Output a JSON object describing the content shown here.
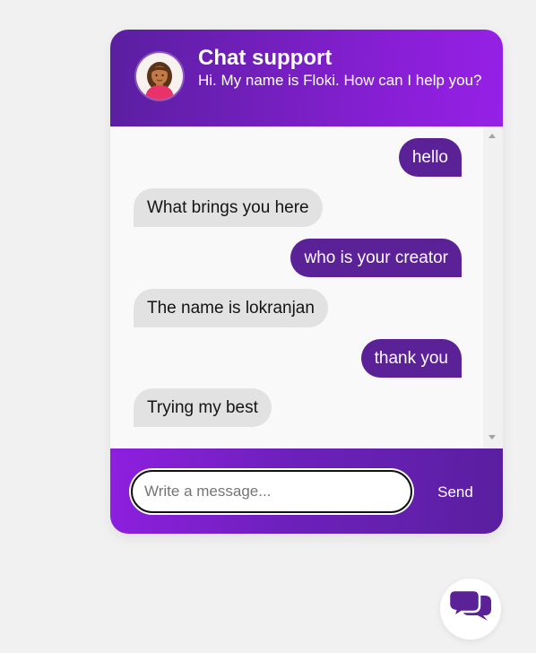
{
  "colors": {
    "accent": "#5b2298",
    "accent_light": "#9620e6",
    "received_bubble": "#e2e2e2",
    "page_bg": "#f1f1f1"
  },
  "header": {
    "title": "Chat support",
    "subtitle": "Hi. My name is Floki. How can I help you?",
    "avatar_icon": "woman-avatar-icon"
  },
  "messages": [
    {
      "sender": "user",
      "text": "hello"
    },
    {
      "sender": "bot",
      "text": "What brings you here"
    },
    {
      "sender": "user",
      "text": "who is your creator"
    },
    {
      "sender": "bot",
      "text": "The name is lokranjan"
    },
    {
      "sender": "user",
      "text": "thank you"
    },
    {
      "sender": "bot",
      "text": "Trying my best"
    }
  ],
  "input": {
    "placeholder": "Write a message...",
    "value": ""
  },
  "send_label": "Send",
  "launcher_icon": "chat-bubbles-icon"
}
